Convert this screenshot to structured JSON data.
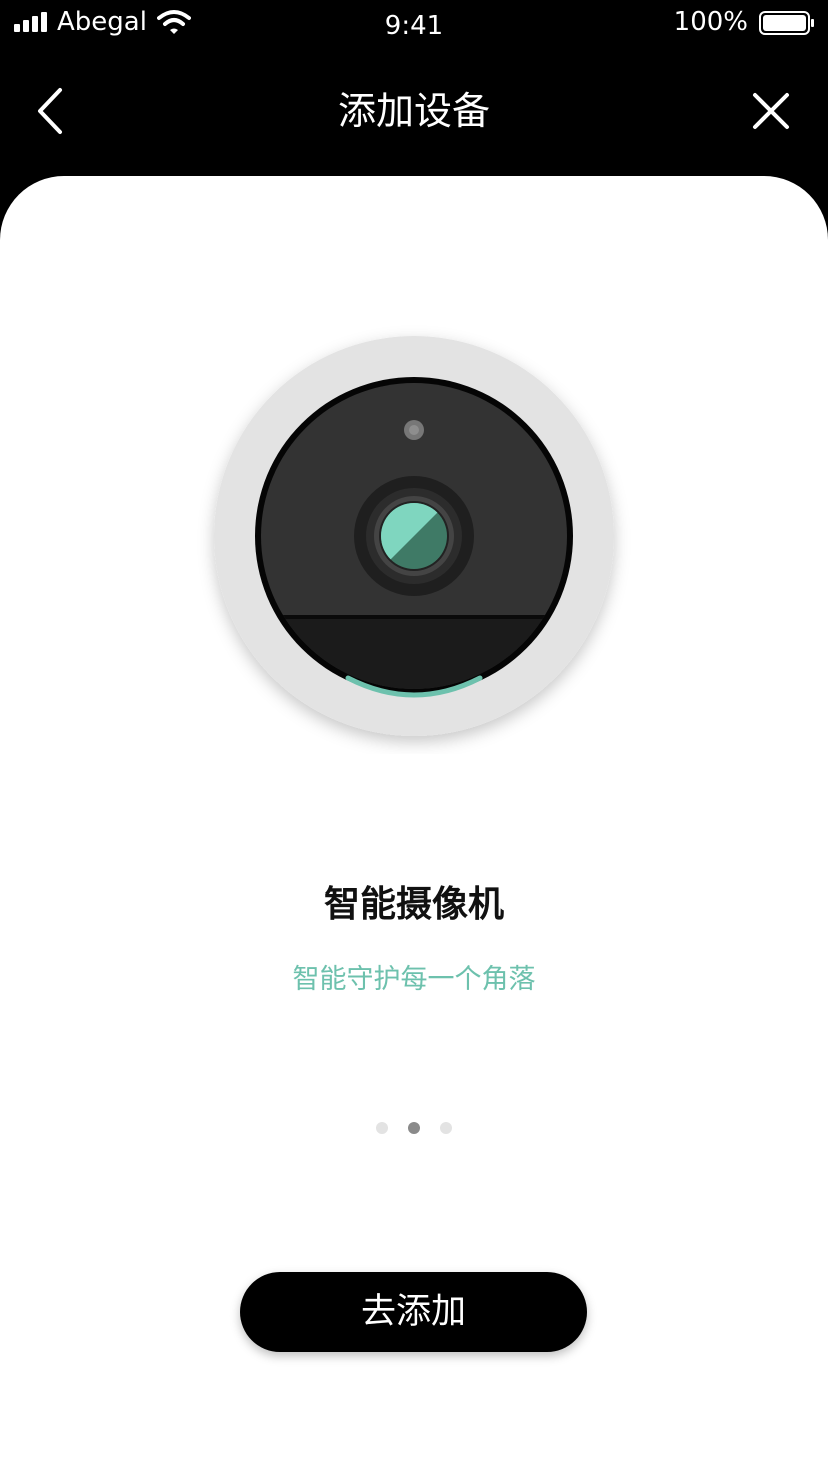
{
  "status_bar": {
    "carrier": "Abegal",
    "time": "9:41",
    "battery_percent": "100%"
  },
  "nav": {
    "title": "添加设备",
    "back_icon": "chevron-left-icon",
    "close_icon": "close-icon"
  },
  "device": {
    "title": "智能摄像机",
    "subtitle": "智能守护每一个角落",
    "illustration": "security-camera-illustration"
  },
  "pager": {
    "count": 3,
    "active_index": 1
  },
  "actions": {
    "add_label": "去添加"
  },
  "colors": {
    "background": "#000000",
    "card": "#ffffff",
    "accent": "#6dc1ad",
    "button": "#000000",
    "dot_active": "#8a8a8a",
    "dot_inactive": "#e3e3e3"
  }
}
